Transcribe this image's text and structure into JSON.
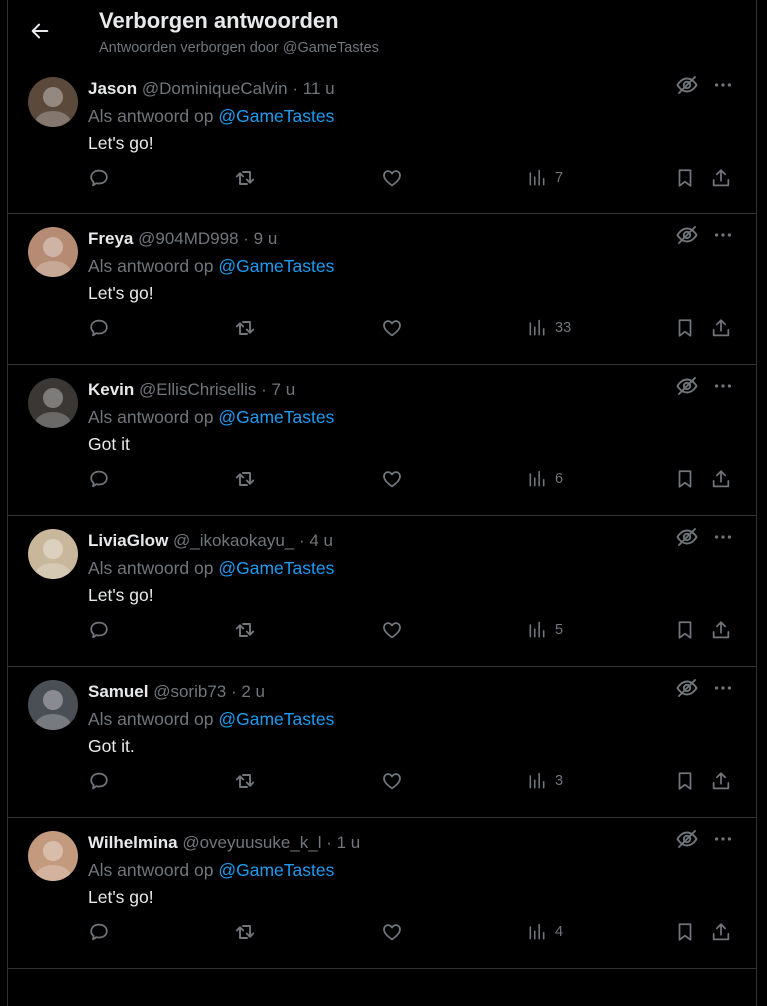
{
  "header": {
    "title": "Verborgen antwoorden",
    "subtitle": "Antwoorden verborgen door @GameTastes"
  },
  "reply_prefix": "Als antwoord op ",
  "reply_to": "@GameTastes",
  "separator": "·",
  "tweets": [
    {
      "name": "Jason",
      "handle": "@DominiqueCalvin",
      "time": "11 u",
      "text": "Let's go!",
      "views": "7",
      "avatar_color": "#5b4a3c"
    },
    {
      "name": "Freya",
      "handle": "@904MD998",
      "time": "9 u",
      "text": "Let's go!",
      "views": "33",
      "avatar_color": "#b58b74"
    },
    {
      "name": "Kevin",
      "handle": "@EllisChrisellis",
      "time": "7 u",
      "text": "Got it",
      "views": "6",
      "avatar_color": "#3a3735"
    },
    {
      "name": "LiviaGlow",
      "handle": "@_ikokaokayu_",
      "time": "4 u",
      "text": "Let's go!",
      "views": "5",
      "avatar_color": "#c9b79b"
    },
    {
      "name": "Samuel",
      "handle": "@sorib73",
      "time": "2 u",
      "text": "Got it.",
      "views": "3",
      "avatar_color": "#4a4e55"
    },
    {
      "name": "Wilhelmina",
      "handle": "@oveyuusuke_k_l",
      "time": "1 u",
      "text": "Let's go!",
      "views": "4",
      "avatar_color": "#c49a7e"
    }
  ],
  "colors": {
    "background": "#000000",
    "text": "#e7e9ea",
    "muted": "#71767b",
    "accent": "#1d9bf0",
    "border": "#2f3336"
  }
}
